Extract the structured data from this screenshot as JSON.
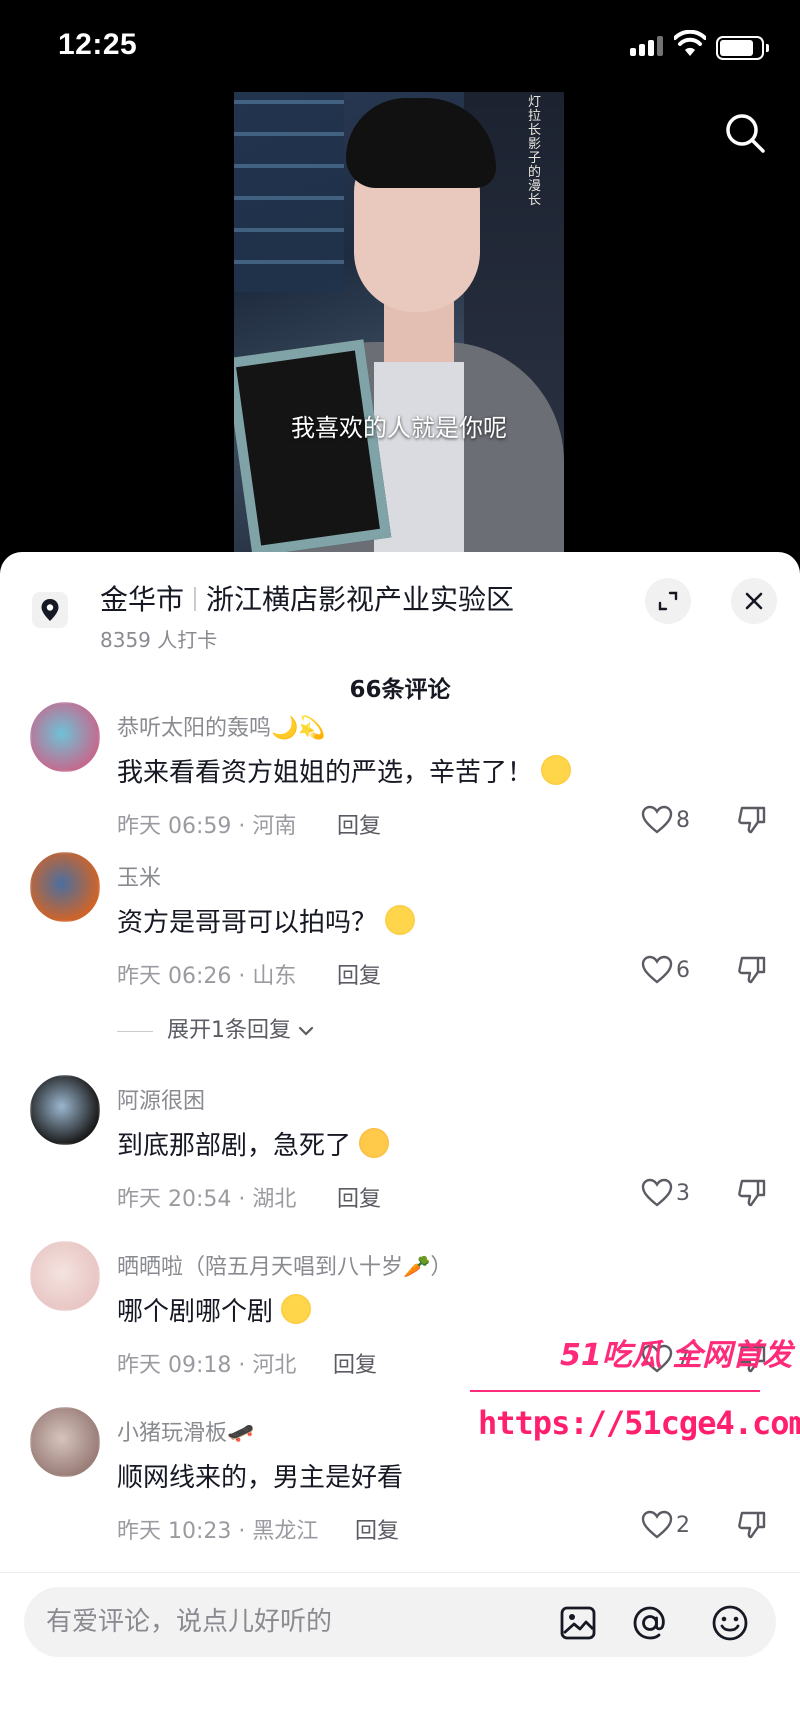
{
  "status_bar": {
    "time": "12:25",
    "battery_level": 0.85
  },
  "video": {
    "subtitle": "我喜欢的人就是你呢",
    "overlay_vertical_text": "灯拉长影子的漫长"
  },
  "location": {
    "city": "金华市",
    "place": "浙江横店影视产业实验区",
    "checkins": "8359 人打卡"
  },
  "comments_header": "66条评论",
  "comments": [
    {
      "name": "恭听太阳的轰鸣🌙💫",
      "text": "我来看看资方姐姐的严选，辛苦了！",
      "meta": "昨天 06:59 · 河南",
      "reply": "回复",
      "likes": "8",
      "colors": [
        "#c46a8e",
        "#6ec2d7"
      ]
    },
    {
      "name": "玉米",
      "text": "资方是哥哥可以拍吗？",
      "meta": "昨天 06:26 · 山东",
      "reply": "回复",
      "likes": "6",
      "colors": [
        "#d06428",
        "#4a6fa0"
      ],
      "expand_label": "展开1条回复"
    },
    {
      "name": "阿源很困",
      "text": "到底那部剧，急死了",
      "meta": "昨天 20:54 · 湖北",
      "reply": "回复",
      "likes": "3",
      "colors": [
        "#1a1a1a",
        "#9cb8d0"
      ]
    },
    {
      "name": "晒晒啦（陪五月天唱到八十岁🥕）",
      "text": "哪个剧哪个剧",
      "meta": "昨天 09:18 · 河北",
      "reply": "回复",
      "likes": "7",
      "colors": [
        "#e8c6c4",
        "#f4e3df"
      ]
    },
    {
      "name": "小猪玩滑板🛹",
      "text": "顺网线来的，男主是好看",
      "meta": "昨天 10:23 · 黑龙江",
      "reply": "回复",
      "likes": "2",
      "colors": [
        "#9a7d78",
        "#d6c4bd"
      ]
    }
  ],
  "watermark": {
    "brand": "51吃瓜 全网首发",
    "url": "https://51cge4.com"
  },
  "input": {
    "placeholder": "有爱评论，说点儿好听的"
  },
  "icons": {
    "search": "search-icon",
    "pin": "location-pin-icon",
    "expand": "expand-icon",
    "close": "close-icon",
    "like": "heart-icon",
    "dislike": "thumbs-down-icon",
    "image": "image-icon",
    "mention": "at-icon",
    "emoji": "smiley-icon"
  }
}
